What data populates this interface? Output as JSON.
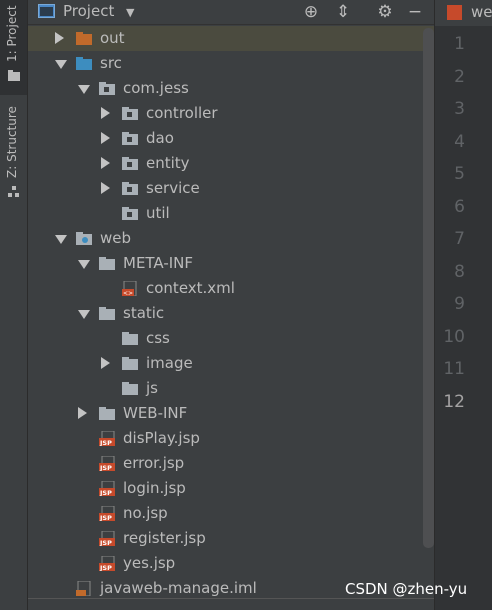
{
  "side_strip": {
    "project_tab": "1: Project",
    "structure_tab": "Z: Structure"
  },
  "header": {
    "title": "Project",
    "icons": [
      "project-view-icon",
      "crosshair-icon",
      "collapse-all-icon",
      "gear-icon",
      "minimize-icon"
    ]
  },
  "editor": {
    "tab_label": "we",
    "line_numbers": [
      "1",
      "2",
      "3",
      "4",
      "5",
      "6",
      "7",
      "8",
      "9",
      "10",
      "11",
      "12"
    ],
    "current_line": "12"
  },
  "tree": [
    {
      "label": "out",
      "depth": 0,
      "arrow": "right",
      "icon": "folder-orange-icon",
      "selected": true
    },
    {
      "label": "src",
      "depth": 0,
      "arrow": "down",
      "icon": "folder-blue-icon"
    },
    {
      "label": "com.jess",
      "depth": 1,
      "arrow": "down",
      "icon": "package-icon"
    },
    {
      "label": "controller",
      "depth": 2,
      "arrow": "right",
      "icon": "package-icon"
    },
    {
      "label": "dao",
      "depth": 2,
      "arrow": "right",
      "icon": "package-icon"
    },
    {
      "label": "entity",
      "depth": 2,
      "arrow": "right",
      "icon": "package-icon"
    },
    {
      "label": "service",
      "depth": 2,
      "arrow": "right",
      "icon": "package-icon"
    },
    {
      "label": "util",
      "depth": 2,
      "arrow": "none",
      "icon": "package-icon"
    },
    {
      "label": "web",
      "depth": 0,
      "arrow": "down",
      "icon": "web-folder-icon"
    },
    {
      "label": "META-INF",
      "depth": 1,
      "arrow": "down",
      "icon": "folder-gray-icon"
    },
    {
      "label": "context.xml",
      "depth": 2,
      "arrow": "none",
      "icon": "xml-file-icon"
    },
    {
      "label": "static",
      "depth": 1,
      "arrow": "down",
      "icon": "folder-gray-icon"
    },
    {
      "label": "css",
      "depth": 2,
      "arrow": "none",
      "icon": "folder-gray-icon"
    },
    {
      "label": "image",
      "depth": 2,
      "arrow": "right",
      "icon": "folder-gray-icon"
    },
    {
      "label": "js",
      "depth": 2,
      "arrow": "none",
      "icon": "folder-gray-icon"
    },
    {
      "label": "WEB-INF",
      "depth": 1,
      "arrow": "right",
      "icon": "folder-gray-icon"
    },
    {
      "label": "disPlay.jsp",
      "depth": 1,
      "arrow": "none",
      "icon": "jsp-file-icon"
    },
    {
      "label": "error.jsp",
      "depth": 1,
      "arrow": "none",
      "icon": "jsp-file-icon"
    },
    {
      "label": "login.jsp",
      "depth": 1,
      "arrow": "none",
      "icon": "jsp-file-icon"
    },
    {
      "label": "no.jsp",
      "depth": 1,
      "arrow": "none",
      "icon": "jsp-file-icon"
    },
    {
      "label": "register.jsp",
      "depth": 1,
      "arrow": "none",
      "icon": "jsp-file-icon"
    },
    {
      "label": "yes.jsp",
      "depth": 1,
      "arrow": "none",
      "icon": "jsp-file-icon"
    },
    {
      "label": "javaweb-manage.iml",
      "depth": 0,
      "arrow": "none",
      "icon": "iml-file-icon"
    }
  ],
  "watermark": "CSDN @zhen-yu",
  "colors": {
    "panel_bg": "#3c3f41",
    "selected_row": "#4b4b3f",
    "text": "#bbbbbb",
    "folder_orange": "#c16a2b",
    "folder_blue": "#3d8dbf",
    "folder_gray": "#a9b0b6",
    "jsp_red": "#c64a2b"
  }
}
